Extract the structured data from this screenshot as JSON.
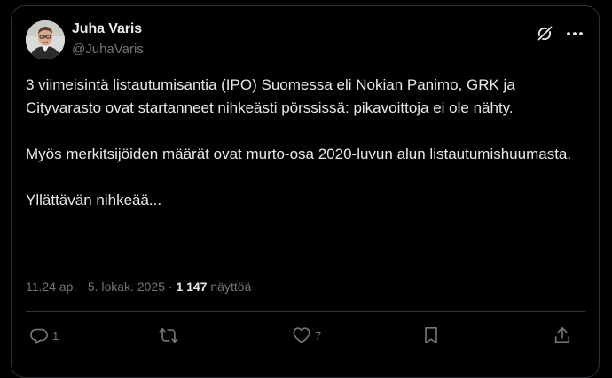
{
  "author": {
    "display_name": "Juha Varis",
    "handle": "@JuhaVaris",
    "avatar_icon": "profile-photo"
  },
  "header_icons": [
    "grok-icon",
    "more-options-icon"
  ],
  "tweet": {
    "paragraphs": [
      "3 viimeisintä listautumisantia (IPO) Suomessa eli Nokian Panimo, GRK ja Cityvarasto ovat startanneet nihkeästi pörssissä: pikavoittoja ei ole nähty.",
      "Myös merkitsijöiden määrät ovat murto-osa 2020-luvun alun listautumishuumasta.",
      "Yllättävän nihkeää..."
    ]
  },
  "meta": {
    "time": "11.24 ap.",
    "separator": "·",
    "date": "5. lokak. 2025",
    "views_count": "1 147",
    "views_label": "näyttöä"
  },
  "actions": {
    "reply_count": "1",
    "retweet_count": "",
    "like_count": "7",
    "icons": [
      "reply-icon",
      "retweet-icon",
      "like-icon",
      "bookmark-icon",
      "share-icon"
    ]
  },
  "colors": {
    "background": "#000000",
    "text_primary": "#e7e9ea",
    "text_secondary": "#71767b",
    "border": "#2f3336"
  }
}
